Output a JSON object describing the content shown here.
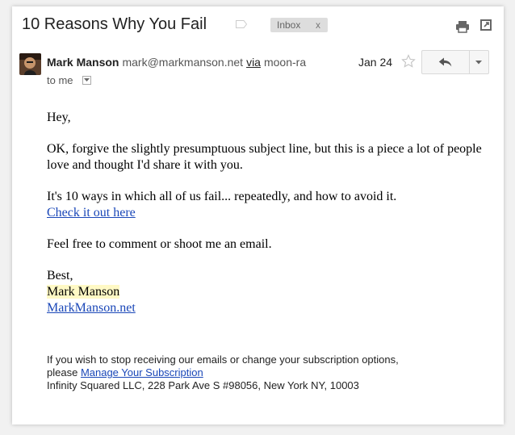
{
  "subject": "10 Reasons Why You Fail",
  "label_chip": {
    "text": "Inbox",
    "remove": "x"
  },
  "sender": {
    "name": "Mark Manson",
    "email": "mark@markmanson.net",
    "via_label": "via",
    "via_domain": "moon-ra"
  },
  "date": "Jan 24",
  "recipient": "to me",
  "body": {
    "greeting": "Hey,",
    "para1": "OK, forgive the slightly presumptuous subject line, but this is a piece a lot of people love and thought I'd share it with you.",
    "para2": "It's 10 ways in which all of us fail... repeatedly, and how to avoid it.",
    "link_check": "Check it out here",
    "para3": "Feel free to comment or shoot me an email.",
    "signoff": "Best,",
    "signature_name": "Mark Manson",
    "signature_link": "MarkManson.net"
  },
  "footer": {
    "line1": "If you wish to stop receiving our emails or change your subscription options,",
    "please": "please",
    "manage_link": "Manage Your Subscription",
    "address": "Infinity Squared LLC, 228 Park Ave S #98056, New York NY, 10003"
  },
  "icons": {
    "label": "label-icon",
    "print": "print-icon",
    "popout": "new-window-icon",
    "star": "star-icon",
    "reply": "reply-icon",
    "more": "dropdown-icon"
  },
  "colors": {
    "link": "#1a47b8",
    "highlight": "#fff9c5",
    "chip_bg": "#dddddd"
  }
}
